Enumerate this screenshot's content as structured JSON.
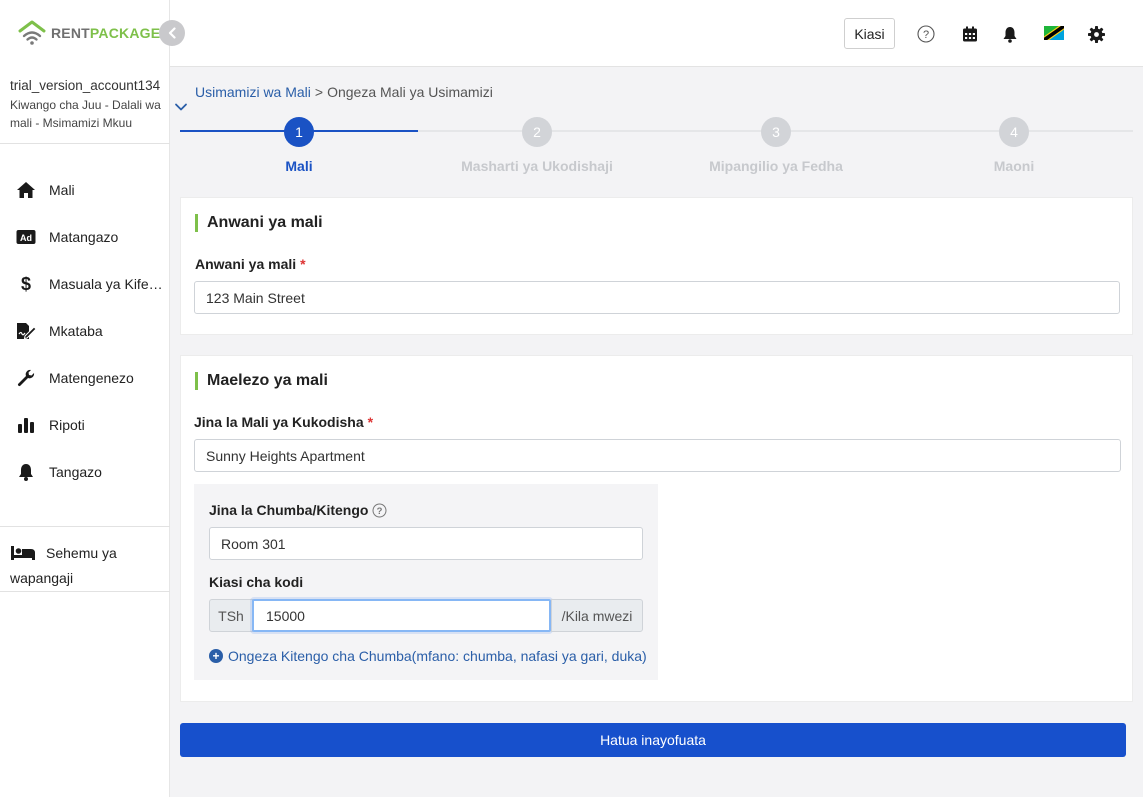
{
  "brand": {
    "rent": "RENT",
    "package": "PACKAGE"
  },
  "account": {
    "name": "trial_version_account134",
    "role": "Kiwango cha Juu - Dalali wa mali - Msimamizi Mkuu"
  },
  "sidebar": {
    "items": [
      {
        "label": "Mali",
        "icon": "home-icon"
      },
      {
        "label": "Matangazo",
        "icon": "ad-icon"
      },
      {
        "label": "Masuala ya Kifedha",
        "icon": "dollar-icon"
      },
      {
        "label": "Mkataba",
        "icon": "contract-icon"
      },
      {
        "label": "Matengenezo",
        "icon": "wrench-icon"
      },
      {
        "label": "Ripoti",
        "icon": "bar-chart-icon"
      },
      {
        "label": "Tangazo",
        "icon": "bell-icon"
      }
    ],
    "tenant_section": "Sehemu ya wapangaji"
  },
  "topbar": {
    "kiasi_label": "Kiasi"
  },
  "breadcrumb": {
    "parent": "Usimamizi wa Mali",
    "separator": ">",
    "current": "Ongeza Mali ya Usimamizi"
  },
  "stepper": {
    "steps": [
      {
        "number": "1",
        "label": "Mali",
        "active": true
      },
      {
        "number": "2",
        "label": "Masharti ya Ukodishaji",
        "active": false
      },
      {
        "number": "3",
        "label": "Mipangilio ya Fedha",
        "active": false
      },
      {
        "number": "4",
        "label": "Maoni",
        "active": false
      }
    ]
  },
  "address_card": {
    "title": "Anwani ya mali",
    "field_label": "Anwani ya mali",
    "required_mark": "*",
    "value": "123 Main Street"
  },
  "details_card": {
    "title": "Maelezo ya mali",
    "name_label": "Jina la Mali ya Kukodisha",
    "required_mark": "*",
    "name_value": "Sunny Heights Apartment",
    "unit_label": "Jina la Chumba/Kitengo",
    "unit_value": "Room 301",
    "rent_label": "Kiasi cha kodi",
    "currency": "TSh",
    "rent_value": "15000",
    "period": "/Kila mwezi",
    "add_unit_link": "Ongeza Kitengo cha Chumba(mfano: chumba, nafasi ya gari, duka)"
  },
  "next_button": "Hatua inayofuata",
  "colors": {
    "brand_green": "#7ec04a",
    "primary_blue": "#1750cc",
    "link_blue": "#2a5ea8",
    "step_active": "#1a52c4",
    "step_inactive": "#d2d4d8"
  }
}
